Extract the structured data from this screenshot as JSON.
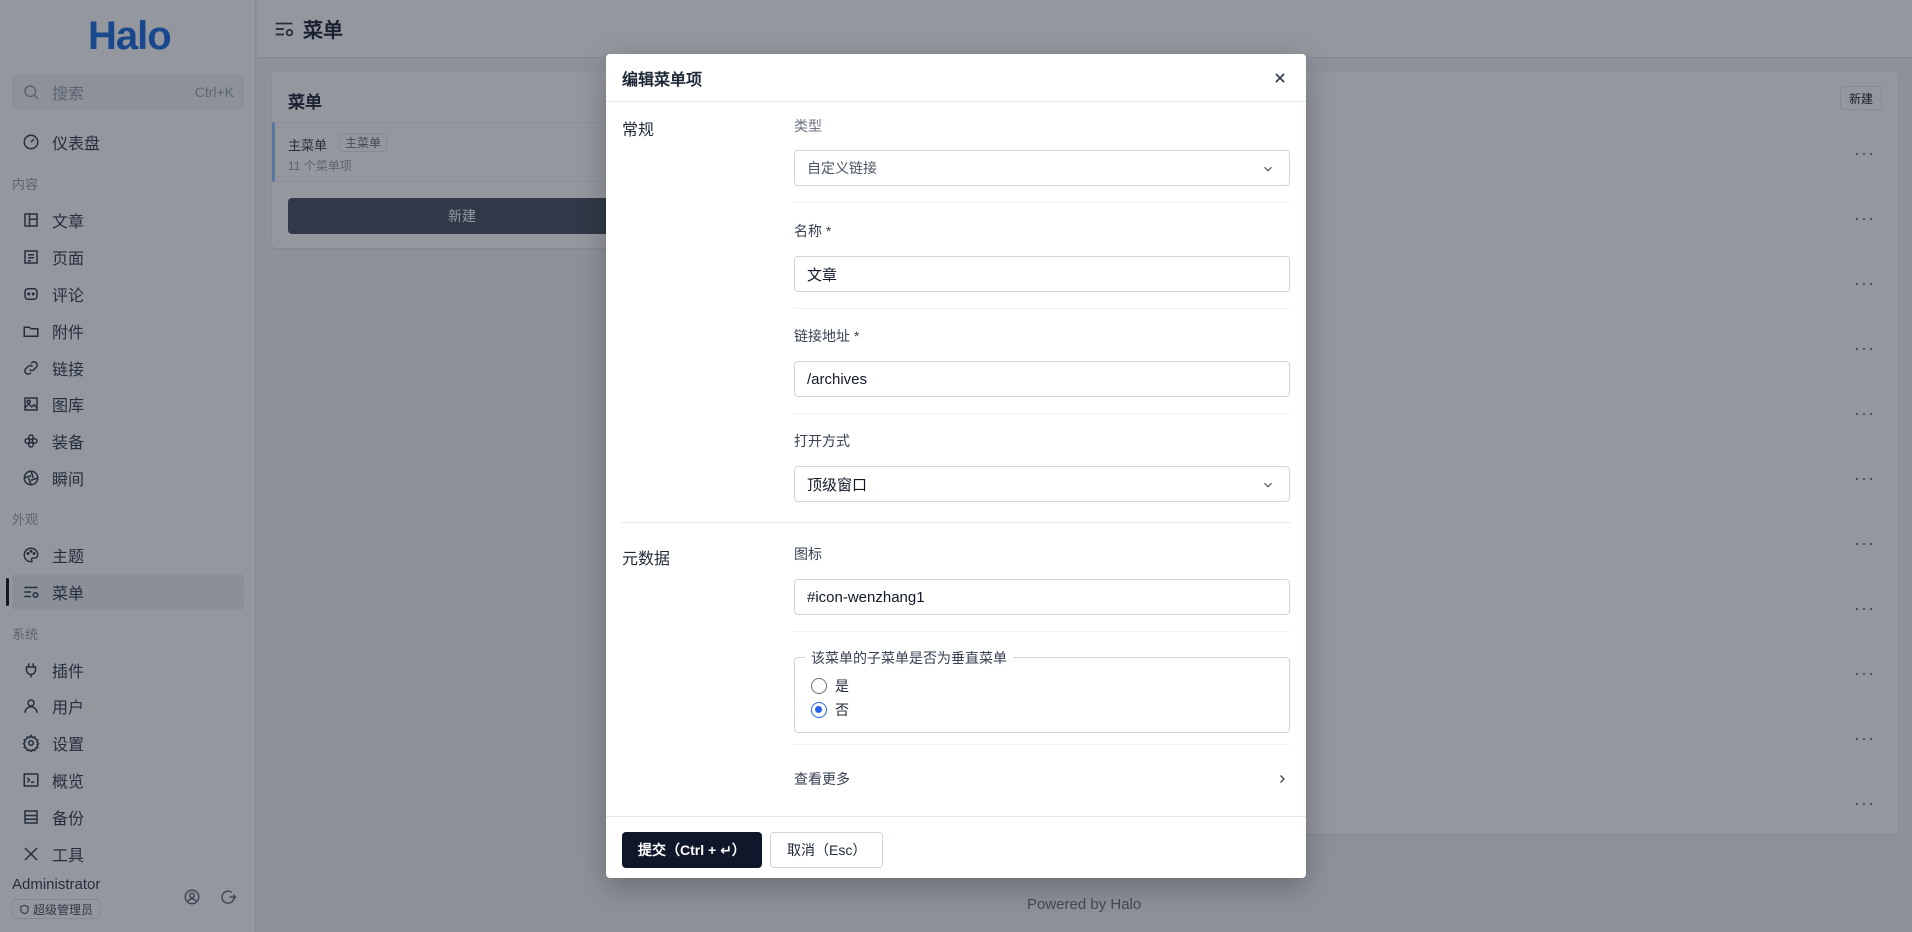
{
  "app": {
    "logo": "Halo",
    "search_placeholder": "搜索",
    "search_shortcut": "Ctrl+K"
  },
  "sidebar": {
    "dashboard": "仪表盘",
    "groups": {
      "content": "内容",
      "appearance": "外观",
      "system": "系统"
    },
    "content_items": [
      "文章",
      "页面",
      "评论",
      "附件",
      "链接",
      "图库",
      "装备",
      "瞬间"
    ],
    "appearance_items": [
      "主题",
      "菜单"
    ],
    "system_items": [
      "插件",
      "用户",
      "设置",
      "概览",
      "备份",
      "工具"
    ],
    "user_name": "Administrator",
    "user_role": "超级管理员"
  },
  "header": {
    "title": "菜单"
  },
  "left_panel": {
    "title": "菜单",
    "menu_name": "主菜单",
    "menu_tag": "主菜单",
    "menu_count": "11 个菜单项",
    "new_label": "新建"
  },
  "right_panel": {
    "new_label": "新建"
  },
  "footer": {
    "text": "Powered by Halo"
  },
  "modal": {
    "title": "编辑菜单项",
    "sections": {
      "general": "常规",
      "metadata": "元数据"
    },
    "fields": {
      "type_label": "类型",
      "type_value": "自定义链接",
      "name_label": "名称 *",
      "name_value": "文章",
      "link_label": "链接地址 *",
      "link_value": "/archives",
      "target_label": "打开方式",
      "target_value": "顶级窗口",
      "icon_label": "图标",
      "icon_value": "#icon-wenzhang1",
      "vertical_legend": "该菜单的子菜单是否为垂直菜单",
      "opt_yes": "是",
      "opt_no": "否",
      "selected": "否",
      "more_label": "查看更多"
    },
    "submit_label": "提交（Ctrl + ↵）",
    "cancel_label": "取消（Esc）"
  }
}
